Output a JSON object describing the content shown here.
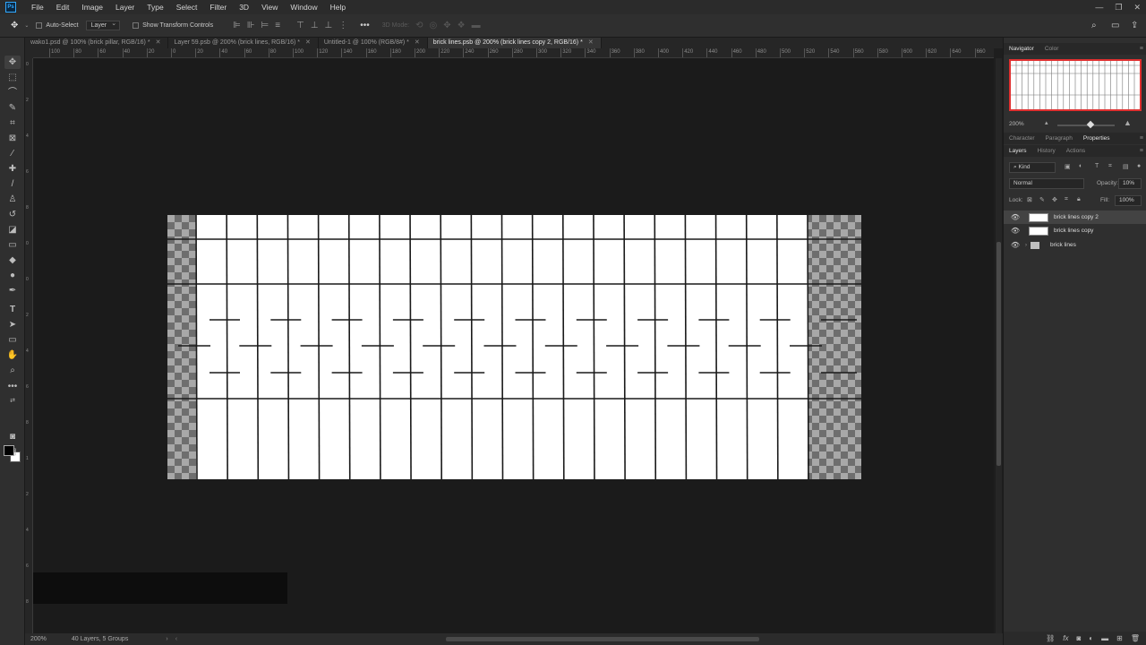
{
  "app": {
    "logo": "Ps"
  },
  "menu": [
    "File",
    "Edit",
    "Image",
    "Layer",
    "Type",
    "Select",
    "Filter",
    "3D",
    "View",
    "Window",
    "Help"
  ],
  "window_controls": {
    "minimize": "—",
    "restore": "❐",
    "close": "✕"
  },
  "options_bar": {
    "auto_select_label": "Auto-Select",
    "auto_select_target": "Layer",
    "show_transform_label": "Show Transform Controls",
    "three_d_mode_label": "3D Mode:"
  },
  "doc_tabs": [
    {
      "label": "wako1.psd @ 100% (brick pillar, RGB/16) *",
      "active": false
    },
    {
      "label": "Layer 59.psb @ 200% (brick lines, RGB/16) *",
      "active": false
    },
    {
      "label": "Untitled-1 @ 100% (RGB/8#) *",
      "active": false
    },
    {
      "label": "brick lines.psb @ 200% (brick lines copy 2, RGB/16) *",
      "active": true
    }
  ],
  "ruler_h_labels": [
    "100",
    "80",
    "60",
    "40",
    "20",
    "0",
    "20",
    "40",
    "60",
    "80",
    "100",
    "120",
    "140",
    "160",
    "180",
    "200",
    "220",
    "240",
    "260",
    "280",
    "300",
    "320",
    "340",
    "360",
    "380",
    "400",
    "420",
    "440",
    "460",
    "480",
    "500",
    "520",
    "540",
    "560",
    "580",
    "600",
    "620",
    "640",
    "660"
  ],
  "ruler_v_labels": [
    "0",
    "2",
    "4",
    "6",
    "8",
    "0",
    "0",
    "2",
    "4",
    "6",
    "8",
    "1",
    "2",
    "4",
    "6",
    "8"
  ],
  "status": {
    "zoom": "200%",
    "info": "40 Layers, 5 Groups"
  },
  "panels": {
    "top_tabs": [
      "Navigator",
      "Color"
    ],
    "navigator_zoom": "200%",
    "mid_tabs": [
      "Character",
      "Paragraph",
      "Properties"
    ],
    "layer_tabs": [
      "Layers",
      "History",
      "Actions"
    ],
    "filter_kind": "Kind",
    "blend_mode": "Normal",
    "opacity_label": "Opacity:",
    "opacity_value": "10%",
    "lock_label": "Lock:",
    "fill_label": "Fill:",
    "fill_value": "100%"
  },
  "layers": [
    {
      "name": "brick lines copy 2",
      "type": "layer",
      "visible": true,
      "selected": true
    },
    {
      "name": "brick lines copy",
      "type": "layer",
      "visible": true,
      "selected": false
    },
    {
      "name": "brick lines",
      "type": "group",
      "visible": true,
      "selected": false
    }
  ],
  "canvas": {
    "background": "#1b1b1b",
    "content": "brick line pattern on transparent checkerboard",
    "line_color": "#1a1a1a",
    "fill_color": "#ffffff"
  }
}
